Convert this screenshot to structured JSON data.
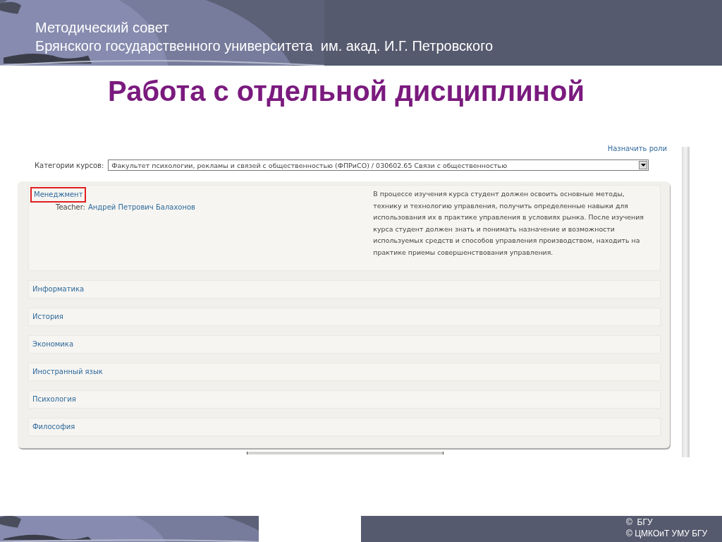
{
  "header": {
    "lines": [
      "Методический совет",
      "Брянского государственного университета  им. акад. И.Г. Петровского"
    ]
  },
  "title": "Работа с отдельной дисциплиной",
  "page": {
    "assign_roles_link": "Назначить роли",
    "category": {
      "label": "Категории курсов:",
      "value": "Факультет психологии, рекламы и связей с общественностью (ФПРиСО) / 030602.65 Связи с общественностью"
    },
    "courses": [
      {
        "name": "Менеджмент",
        "highlighted": true,
        "teacher_label": "Teacher:",
        "teacher_name": "Андрей Петрович Балахонов",
        "description": "В процессе изучения курса студент должен освоить основные методы, технику и технологию управления, получить определенные навыки для использования их в практике управления в условиях рынка. После изучения курса студент должен знать и понимать назначение и возможности используемых средств и способов управления производством, находить на практике приемы совершенствования управления."
      },
      {
        "name": "Информатика",
        "highlighted": false
      },
      {
        "name": "История",
        "highlighted": false
      },
      {
        "name": "Экономика",
        "highlighted": false
      },
      {
        "name": "Иностранный язык",
        "highlighted": false
      },
      {
        "name": "Психология",
        "highlighted": false
      },
      {
        "name": "Философия",
        "highlighted": false
      }
    ]
  },
  "footer": {
    "lines": [
      "©  БГУ",
      "© ЦМКОиТ УМУ БГУ"
    ]
  }
}
